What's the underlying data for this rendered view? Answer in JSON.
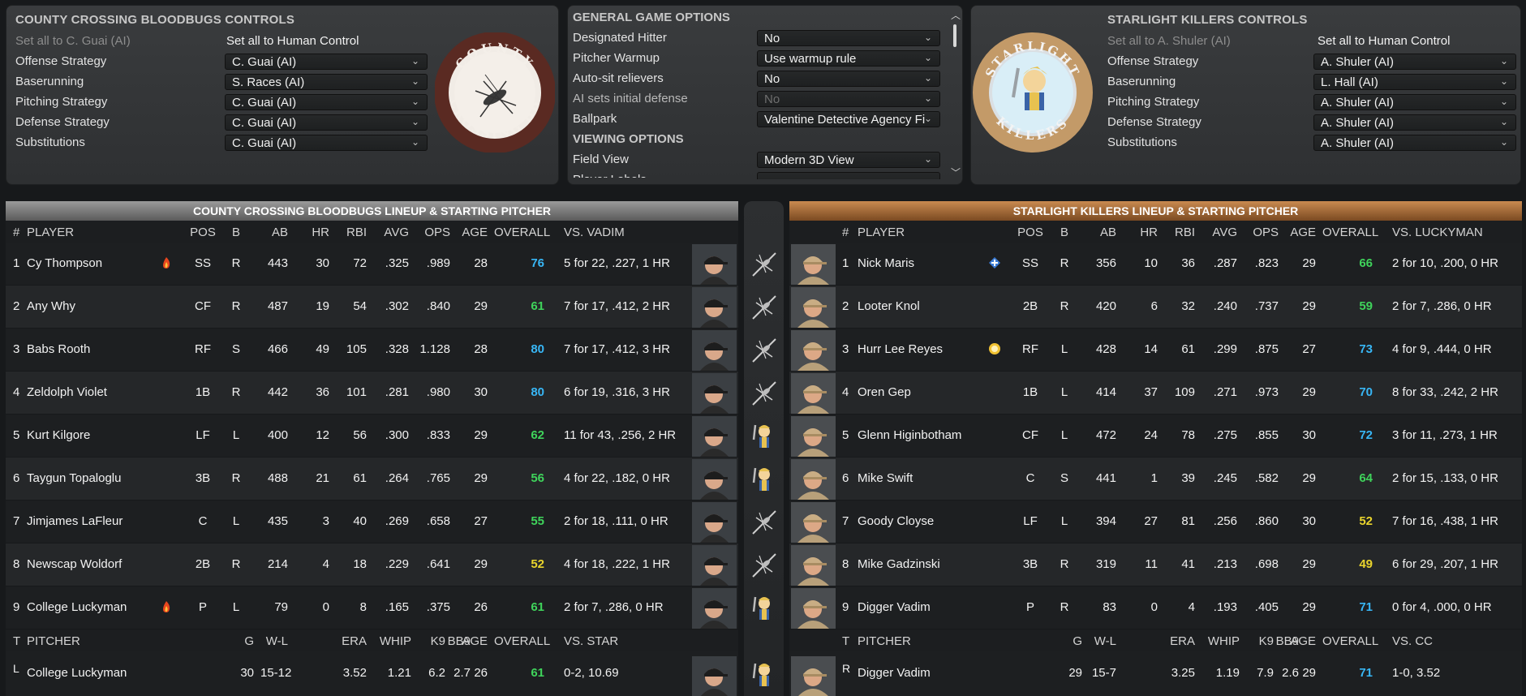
{
  "left_controls": {
    "title": "COUNTY CROSSING BLOODBUGS CONTROLS",
    "set_ai": "Set all to C. Guai (AI)",
    "set_human": "Set all to Human Control",
    "rows": [
      {
        "label": "Offense Strategy",
        "value": "C. Guai (AI)"
      },
      {
        "label": "Baserunning",
        "value": "S. Races (AI)"
      },
      {
        "label": "Pitching Strategy",
        "value": "C. Guai (AI)"
      },
      {
        "label": "Defense Strategy",
        "value": "C. Guai (AI)"
      },
      {
        "label": "Substitutions",
        "value": "C. Guai (AI)"
      }
    ],
    "logo_text": "COUNTY CROSSING BB"
  },
  "options": {
    "section1": "GENERAL GAME OPTIONS",
    "section2": "VIEWING OPTIONS",
    "rows": [
      {
        "label": "Designated Hitter",
        "value": "No"
      },
      {
        "label": "Pitcher Warmup",
        "value": "Use warmup rule"
      },
      {
        "label": "Auto-sit relievers",
        "value": "No"
      },
      {
        "label": "AI sets initial defense",
        "value": "No"
      },
      {
        "label": "Ballpark",
        "value": "Valentine Detective Agency Fi"
      }
    ],
    "view_rows": [
      {
        "label": "Field View",
        "value": "Modern 3D View"
      },
      {
        "label": "Player Labels",
        "value": ""
      }
    ]
  },
  "right_controls": {
    "title": "STARLIGHT KILLERS CONTROLS",
    "set_ai": "Set all to A. Shuler (AI)",
    "set_human": "Set all to Human Control",
    "rows": [
      {
        "label": "Offense Strategy",
        "value": "A. Shuler (AI)"
      },
      {
        "label": "Baserunning",
        "value": "L. Hall (AI)"
      },
      {
        "label": "Pitching Strategy",
        "value": "A. Shuler (AI)"
      },
      {
        "label": "Defense Strategy",
        "value": "A. Shuler (AI)"
      },
      {
        "label": "Substitutions",
        "value": "A. Shuler (AI)"
      }
    ],
    "logo_text_top": "STARLIGHT",
    "logo_text_bottom": "KILLERS"
  },
  "left_lineup": {
    "header": "COUNTY CROSSING BLOODBUGS LINEUP & STARTING PITCHER",
    "cols": {
      "num": "#",
      "player": "PLAYER",
      "pos": "POS",
      "b": "B",
      "ab": "AB",
      "hr": "HR",
      "rbi": "RBI",
      "avg": "AVG",
      "ops": "OPS",
      "age": "AGE",
      "overall": "OVERALL",
      "vs": "VS. VADIM"
    },
    "players": [
      {
        "num": "1",
        "name": "Cy Thompson",
        "badge": "fire",
        "pos": "SS",
        "b": "R",
        "ab": "443",
        "hr": "30",
        "rbi": "72",
        "avg": ".325",
        "ops": ".989",
        "age": "28",
        "overall": "76",
        "tier": "blue",
        "vs": "5 for 22, .227, 1 HR"
      },
      {
        "num": "2",
        "name": "Any Why",
        "badge": "",
        "pos": "CF",
        "b": "R",
        "ab": "487",
        "hr": "19",
        "rbi": "54",
        "avg": ".302",
        "ops": ".840",
        "age": "29",
        "overall": "61",
        "tier": "green",
        "vs": "7 for 17, .412, 2 HR"
      },
      {
        "num": "3",
        "name": "Babs Rooth",
        "badge": "",
        "pos": "RF",
        "b": "S",
        "ab": "466",
        "hr": "49",
        "rbi": "105",
        "avg": ".328",
        "ops": "1.128",
        "age": "28",
        "overall": "80",
        "tier": "blue",
        "vs": "7 for 17, .412, 3 HR"
      },
      {
        "num": "4",
        "name": "Zeldolph Violet",
        "badge": "",
        "pos": "1B",
        "b": "R",
        "ab": "442",
        "hr": "36",
        "rbi": "101",
        "avg": ".281",
        "ops": ".980",
        "age": "30",
        "overall": "80",
        "tier": "blue",
        "vs": "6 for 19, .316, 3 HR"
      },
      {
        "num": "5",
        "name": "Kurt Kilgore",
        "badge": "",
        "pos": "LF",
        "b": "L",
        "ab": "400",
        "hr": "12",
        "rbi": "56",
        "avg": ".300",
        "ops": ".833",
        "age": "29",
        "overall": "62",
        "tier": "green",
        "vs": "11 for 43, .256, 2 HR"
      },
      {
        "num": "6",
        "name": "Taygun Topaloglu",
        "badge": "",
        "pos": "3B",
        "b": "R",
        "ab": "488",
        "hr": "21",
        "rbi": "61",
        "avg": ".264",
        "ops": ".765",
        "age": "29",
        "overall": "56",
        "tier": "green",
        "vs": "4 for 22, .182, 0 HR"
      },
      {
        "num": "7",
        "name": "Jimjames LaFleur",
        "badge": "",
        "pos": "C",
        "b": "L",
        "ab": "435",
        "hr": "3",
        "rbi": "40",
        "avg": ".269",
        "ops": ".658",
        "age": "27",
        "overall": "55",
        "tier": "green",
        "vs": "2 for 18, .111, 0 HR"
      },
      {
        "num": "8",
        "name": "Newscap Woldorf",
        "badge": "",
        "pos": "2B",
        "b": "R",
        "ab": "214",
        "hr": "4",
        "rbi": "18",
        "avg": ".229",
        "ops": ".641",
        "age": "29",
        "overall": "52",
        "tier": "yellow",
        "vs": "4 for 18, .222, 1 HR"
      },
      {
        "num": "9",
        "name": "College Luckyman",
        "badge": "fire",
        "pos": "P",
        "b": "L",
        "ab": "79",
        "hr": "0",
        "rbi": "8",
        "avg": ".165",
        "ops": ".375",
        "age": "26",
        "overall": "61",
        "tier": "green",
        "vs": "2 for 7, .286, 0 HR"
      }
    ],
    "pitcher_cols": {
      "t": "T",
      "pitcher": "PITCHER",
      "g": "G",
      "wl": "W-L",
      "era": "ERA",
      "whip": "WHIP",
      "k9": "K9",
      "bb9": "BB9",
      "age": "AGE",
      "overall": "OVERALL",
      "vs": "VS. STAR"
    },
    "pitcher": {
      "t": "L",
      "name": "College Luckyman",
      "g": "30",
      "wl": "15-12",
      "era": "3.52",
      "whip": "1.21",
      "k9": "6.2",
      "bb9": "2.7",
      "age": "26",
      "overall": "61",
      "tier": "green",
      "vs": "0-2, 10.69"
    }
  },
  "right_lineup": {
    "header": "STARLIGHT KILLERS LINEUP & STARTING PITCHER",
    "cols": {
      "num": "#",
      "player": "PLAYER",
      "pos": "POS",
      "b": "B",
      "ab": "AB",
      "hr": "HR",
      "rbi": "RBI",
      "avg": "AVG",
      "ops": "OPS",
      "age": "AGE",
      "overall": "OVERALL",
      "vs": "VS. LUCKYMAN"
    },
    "players": [
      {
        "num": "1",
        "name": "Nick Maris",
        "badge": "plus",
        "pos": "SS",
        "b": "R",
        "ab": "356",
        "hr": "10",
        "rbi": "36",
        "avg": ".287",
        "ops": ".823",
        "age": "29",
        "overall": "66",
        "tier": "green",
        "vs": "2 for 10, .200, 0 HR"
      },
      {
        "num": "2",
        "name": "Looter Knol",
        "badge": "",
        "pos": "2B",
        "b": "R",
        "ab": "420",
        "hr": "6",
        "rbi": "32",
        "avg": ".240",
        "ops": ".737",
        "age": "29",
        "overall": "59",
        "tier": "green",
        "vs": "2 for 7, .286, 0 HR"
      },
      {
        "num": "3",
        "name": "Hurr Lee Reyes",
        "badge": "coin",
        "pos": "RF",
        "b": "L",
        "ab": "428",
        "hr": "14",
        "rbi": "61",
        "avg": ".299",
        "ops": ".875",
        "age": "27",
        "overall": "73",
        "tier": "blue",
        "vs": "4 for 9, .444, 0 HR"
      },
      {
        "num": "4",
        "name": "Oren Gep",
        "badge": "",
        "pos": "1B",
        "b": "L",
        "ab": "414",
        "hr": "37",
        "rbi": "109",
        "avg": ".271",
        "ops": ".973",
        "age": "29",
        "overall": "70",
        "tier": "blue",
        "vs": "8 for 33, .242, 2 HR"
      },
      {
        "num": "5",
        "name": "Glenn Higinbotham",
        "badge": "",
        "pos": "CF",
        "b": "L",
        "ab": "472",
        "hr": "24",
        "rbi": "78",
        "avg": ".275",
        "ops": ".855",
        "age": "30",
        "overall": "72",
        "tier": "blue",
        "vs": "3 for 11, .273, 1 HR"
      },
      {
        "num": "6",
        "name": "Mike Swift",
        "badge": "",
        "pos": "C",
        "b": "S",
        "ab": "441",
        "hr": "1",
        "rbi": "39",
        "avg": ".245",
        "ops": ".582",
        "age": "29",
        "overall": "64",
        "tier": "green",
        "vs": "2 for 15, .133, 0 HR"
      },
      {
        "num": "7",
        "name": "Goody Cloyse",
        "badge": "",
        "pos": "LF",
        "b": "L",
        "ab": "394",
        "hr": "27",
        "rbi": "81",
        "avg": ".256",
        "ops": ".860",
        "age": "30",
        "overall": "52",
        "tier": "yellow",
        "vs": "7 for 16, .438, 1 HR"
      },
      {
        "num": "8",
        "name": "Mike Gadzinski",
        "badge": "",
        "pos": "3B",
        "b": "R",
        "ab": "319",
        "hr": "11",
        "rbi": "41",
        "avg": ".213",
        "ops": ".698",
        "age": "29",
        "overall": "49",
        "tier": "yellow",
        "vs": "6 for 29, .207, 1 HR"
      },
      {
        "num": "9",
        "name": "Digger Vadim",
        "badge": "",
        "pos": "P",
        "b": "R",
        "ab": "83",
        "hr": "0",
        "rbi": "4",
        "avg": ".193",
        "ops": ".405",
        "age": "29",
        "overall": "71",
        "tier": "blue",
        "vs": "0 for 4, .000, 0 HR"
      }
    ],
    "pitcher_cols": {
      "t": "T",
      "pitcher": "PITCHER",
      "g": "G",
      "wl": "W-L",
      "era": "ERA",
      "whip": "WHIP",
      "k9": "K9",
      "bb9": "BB9",
      "age": "AGE",
      "overall": "OVERALL",
      "vs": "VS. CC"
    },
    "pitcher": {
      "t": "R",
      "name": "Digger Vadim",
      "g": "29",
      "wl": "15-7",
      "era": "3.25",
      "whip": "1.19",
      "k9": "7.9",
      "bb9": "2.6",
      "age": "29",
      "overall": "71",
      "tier": "blue",
      "vs": "1-0, 3.52"
    }
  },
  "center_strip": [
    "mosquito",
    "mosquito",
    "mosquito",
    "mosquito",
    "killer",
    "killer",
    "mosquito",
    "mosquito",
    "killer",
    "killer"
  ],
  "colors": {
    "blue": "#38b6f5",
    "green": "#3fd35b",
    "yellow": "#e9d42d",
    "orange_header": "#c98a50"
  }
}
